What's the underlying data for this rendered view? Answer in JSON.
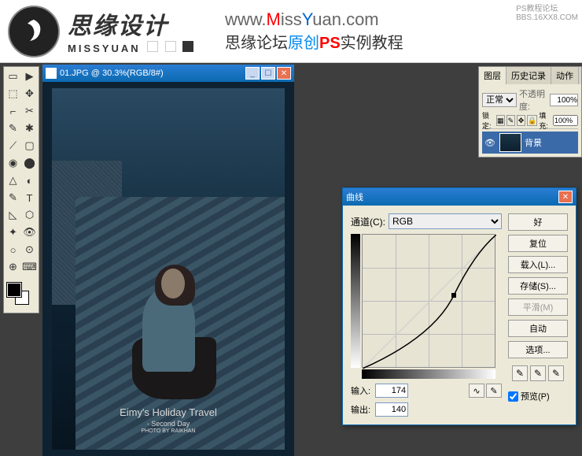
{
  "header": {
    "logo_cn": "思缘设计",
    "logo_en": "MISSYUAN",
    "url_prefix": "www.",
    "url_m": "M",
    "url_iss": "iss",
    "url_y": "Y",
    "url_uan": "uan",
    "url_suffix": ".com",
    "subtitle_a": "思缘论坛",
    "subtitle_orig": "原创",
    "subtitle_ps": "PS",
    "subtitle_b": "实例教程",
    "watermark1": "PS教程论坛",
    "watermark2": "BBS.16XX8.COM"
  },
  "doc": {
    "title": "01.JPG @ 30.3%(RGB/8#)",
    "caption1": "Eimy's Holiday Travel",
    "caption2": "- Second Day",
    "caption3": "PHOTO BY RAIKHAN"
  },
  "curves": {
    "title": "曲线",
    "channel_label": "通道(C):",
    "channel_value": "RGB",
    "input_label": "输入:",
    "input_value": "174",
    "output_label": "输出:",
    "output_value": "140",
    "btn_ok": "好",
    "btn_reset": "复位",
    "btn_load": "载入(L)...",
    "btn_save": "存储(S)...",
    "btn_smooth": "平滑(M)",
    "btn_auto": "自动",
    "btn_options": "选项...",
    "preview": "预览(P)"
  },
  "layers": {
    "tab1": "图层",
    "tab2": "历史记录",
    "tab3": "动作",
    "blend": "正常",
    "opacity_label": "不透明度:",
    "opacity_value": "100%",
    "lock_label": "锁定:",
    "fill_label": "填充:",
    "fill_value": "100%",
    "layer_name": "背景"
  },
  "toolbox": {
    "rows": [
      [
        "▭",
        "▶"
      ],
      [
        "⬚",
        "✥"
      ],
      [
        "⌐",
        "✂"
      ],
      [
        "✎",
        "✱"
      ],
      [
        "⟋",
        "▢"
      ],
      [
        "◉",
        "⬤"
      ],
      [
        "△",
        "◐"
      ],
      [
        "✎",
        "T"
      ],
      [
        "◺",
        "⬡"
      ],
      [
        "✦",
        "👁"
      ],
      [
        "○",
        "⊙"
      ],
      [
        "⊕",
        "⌨"
      ]
    ]
  }
}
